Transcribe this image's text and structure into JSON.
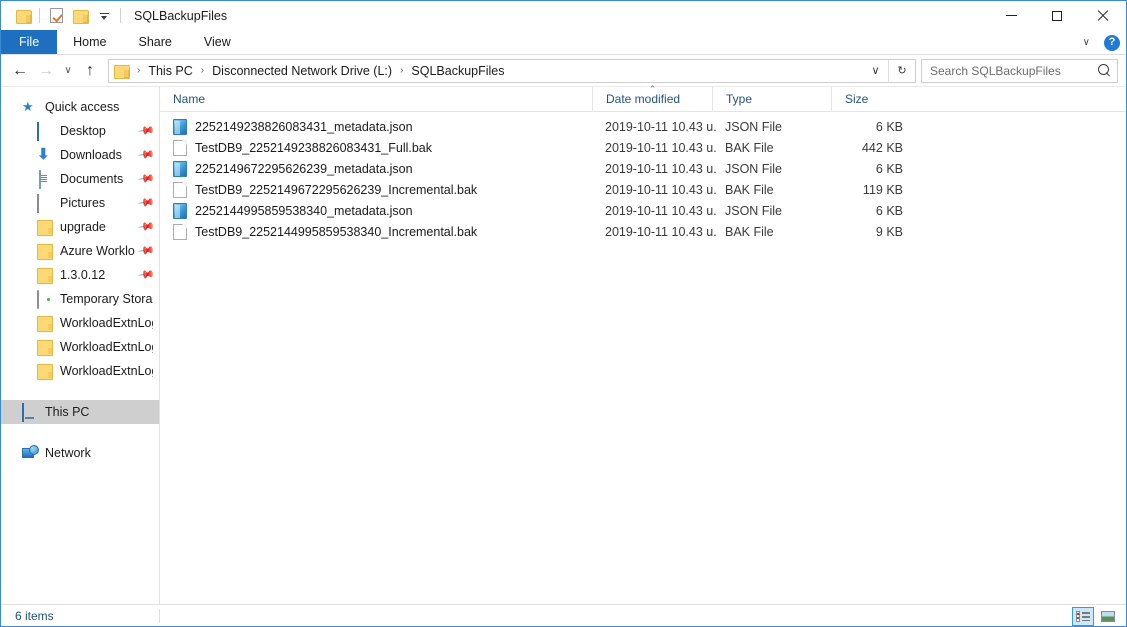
{
  "window": {
    "title": "SQLBackupFiles",
    "quick_access_toolbar": [
      {
        "name": "folder-properties-icon",
        "label": ""
      },
      {
        "name": "properties-icon",
        "label": ""
      },
      {
        "name": "new-folder-icon",
        "label": ""
      },
      {
        "name": "customize-qat-arrow",
        "label": ""
      }
    ],
    "controls": {
      "minimize": "Minimize",
      "maximize": "Maximize",
      "close": "Close"
    }
  },
  "ribbon": {
    "tabs": [
      {
        "label": "File",
        "active": true
      },
      {
        "label": "Home",
        "active": false
      },
      {
        "label": "Share",
        "active": false
      },
      {
        "label": "View",
        "active": false
      }
    ],
    "expand_label": "∨",
    "help_label": "?"
  },
  "address_bar": {
    "back_label": "←",
    "forward_label": "→",
    "recent_label": "∨",
    "up_label": "↑",
    "breadcrumb": [
      "This PC",
      "Disconnected Network Drive (L:)",
      "SQLBackupFiles"
    ],
    "separator": "›",
    "dropdown_label": "∨",
    "refresh_label": "↻"
  },
  "search": {
    "placeholder": "Search SQLBackupFiles",
    "value": ""
  },
  "sidebar": {
    "items": [
      {
        "label": "Quick access",
        "icon": "star-icon",
        "level": 0,
        "pinned": false,
        "selected": false
      },
      {
        "label": "Desktop",
        "icon": "desktop-icon",
        "level": 1,
        "pinned": true,
        "selected": false
      },
      {
        "label": "Downloads",
        "icon": "downloads-icon",
        "level": 1,
        "pinned": true,
        "selected": false
      },
      {
        "label": "Documents",
        "icon": "documents-icon",
        "level": 1,
        "pinned": true,
        "selected": false
      },
      {
        "label": "Pictures",
        "icon": "pictures-icon",
        "level": 1,
        "pinned": true,
        "selected": false
      },
      {
        "label": "upgrade",
        "icon": "folder-icon",
        "level": 1,
        "pinned": true,
        "selected": false
      },
      {
        "label": "Azure Workload",
        "icon": "folder-icon",
        "level": 1,
        "pinned": true,
        "selected": false
      },
      {
        "label": "1.3.0.12",
        "icon": "folder-icon",
        "level": 1,
        "pinned": true,
        "selected": false
      },
      {
        "label": "Temporary Storage",
        "icon": "drive-icon",
        "level": 1,
        "pinned": false,
        "selected": false
      },
      {
        "label": "WorkloadExtnLogFolder",
        "icon": "folder-icon",
        "level": 1,
        "pinned": false,
        "selected": false
      },
      {
        "label": "WorkloadExtnLogFolder",
        "icon": "folder-icon",
        "level": 1,
        "pinned": false,
        "selected": false
      },
      {
        "label": "WorkloadExtnLogFolder",
        "icon": "folder-icon",
        "level": 1,
        "pinned": false,
        "selected": false
      },
      {
        "label": "This PC",
        "icon": "this-pc-icon",
        "level": 0,
        "pinned": false,
        "selected": true
      },
      {
        "label": "Network",
        "icon": "network-icon",
        "level": 0,
        "pinned": false,
        "selected": false
      }
    ]
  },
  "file_list": {
    "columns": [
      {
        "label": "Name",
        "sorted": false
      },
      {
        "label": "Date modified",
        "sorted": true,
        "sort_caret": "⌃"
      },
      {
        "label": "Type",
        "sorted": false
      },
      {
        "label": "Size",
        "sorted": false
      }
    ],
    "rows": [
      {
        "name": "2252149238826083431_metadata.json",
        "icon": "json-file-icon",
        "date_modified": "2019-10-11 10.43 u.",
        "type": "JSON File",
        "size": "6 KB"
      },
      {
        "name": "TestDB9_2252149238826083431_Full.bak",
        "icon": "bak-file-icon",
        "date_modified": "2019-10-11 10.43 u.",
        "type": "BAK File",
        "size": "442 KB"
      },
      {
        "name": "2252149672295626239_metadata.json",
        "icon": "json-file-icon",
        "date_modified": "2019-10-11 10.43 u.",
        "type": "JSON File",
        "size": "6 KB"
      },
      {
        "name": "TestDB9_2252149672295626239_Incremental.bak",
        "icon": "bak-file-icon",
        "date_modified": "2019-10-11 10.43 u.",
        "type": "BAK File",
        "size": "119 KB"
      },
      {
        "name": "2252144995859538340_metadata.json",
        "icon": "json-file-icon",
        "date_modified": "2019-10-11 10.43 u.",
        "type": "JSON File",
        "size": "6 KB"
      },
      {
        "name": "TestDB9_2252144995859538340_Incremental.bak",
        "icon": "bak-file-icon",
        "date_modified": "2019-10-11 10.43 u.",
        "type": "BAK File",
        "size": "9 KB"
      }
    ]
  },
  "status_bar": {
    "item_count": "6 items",
    "view_details_label": "Details view",
    "view_large_icons_label": "Large icons view"
  },
  "colors": {
    "accent_blue": "#1f6fc0",
    "window_border": "#3a8bd4",
    "selection_gray": "#cfcfcf",
    "column_header_text": "#26527d",
    "status_text": "#1f4e79",
    "help_blue": "#1f7bd1",
    "view_active_bg": "#cce8f7"
  }
}
